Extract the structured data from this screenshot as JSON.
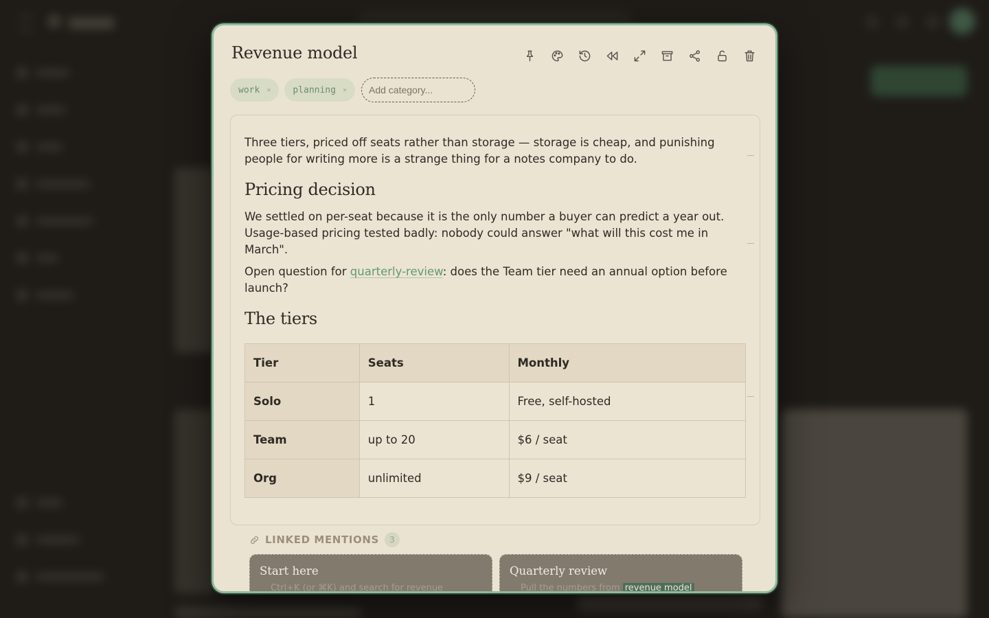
{
  "note": {
    "title": "Revenue model",
    "toolbar": [
      {
        "name": "pin-icon",
        "label": "Pin"
      },
      {
        "name": "palette-icon",
        "label": "Color"
      },
      {
        "name": "history-icon",
        "label": "History"
      },
      {
        "name": "rewind-icon",
        "label": "Revert"
      },
      {
        "name": "expand-icon",
        "label": "Expand"
      },
      {
        "name": "archive-icon",
        "label": "Archive"
      },
      {
        "name": "share-icon",
        "label": "Share"
      },
      {
        "name": "unlock-icon",
        "label": "Lock"
      },
      {
        "name": "trash-icon",
        "label": "Delete"
      }
    ],
    "tags": [
      {
        "label": "work",
        "remove": "×"
      },
      {
        "label": "planning",
        "remove": "×"
      }
    ],
    "category_placeholder": "Add category...",
    "body": {
      "intro": "Three tiers, priced off seats rather than storage — storage is cheap, and punishing people for writing more is a strange thing for a notes company to do.",
      "heading_pricing": "Pricing decision",
      "pricing_para": "We settled on per-seat because it is the only number a buyer can predict a year out. Usage-based pricing tested badly: nobody could answer \"what will this cost me in March\".",
      "question_before": "Open question for ",
      "question_link": "quarterly-review",
      "question_after": ": does the Team tier need an annual option before launch?",
      "heading_tiers": "The tiers"
    },
    "table": {
      "headers": [
        "Tier",
        "Seats",
        "Monthly"
      ],
      "rows": [
        [
          "Solo",
          "1",
          "Free, self-hosted"
        ],
        [
          "Team",
          "up to 20",
          "$6 / seat"
        ],
        [
          "Org",
          "unlimited",
          "$9 / seat"
        ]
      ]
    },
    "linked_mentions": {
      "title": "LINKED MENTIONS",
      "count": "3",
      "cards": [
        {
          "title": "Start here",
          "snippet": "Ctrl+K (or ⌘K) and search for revenue",
          "highlight": ""
        },
        {
          "title": "Quarterly review",
          "snippet": "Pull the numbers from ",
          "highlight": "revenue model"
        }
      ]
    }
  },
  "colors": {
    "accent": "#8fbc9c",
    "link": "#5f9a72",
    "modal_bg": "#ebe3d2",
    "backdrop": "#1f1c18"
  }
}
